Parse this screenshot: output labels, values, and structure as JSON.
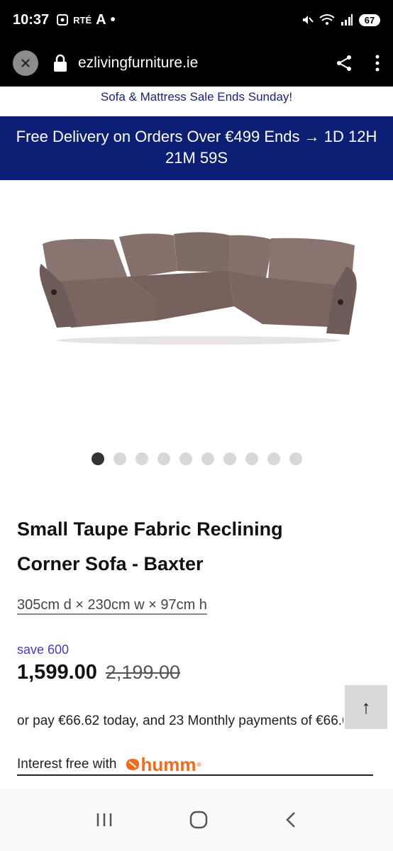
{
  "status_bar": {
    "time": "10:37",
    "left_icons": [
      "screenshot-icon",
      "RTE",
      "A",
      "•"
    ],
    "rte_label": "RTÉ",
    "a_label": "A",
    "dot_label": "•",
    "battery": "67"
  },
  "browser": {
    "url": "ezlivingfurniture.ie"
  },
  "promo_banner": {
    "text": "Sofa & Mattress Sale Ends Sunday!"
  },
  "delivery_banner": {
    "text": "Free Delivery on Orders Over €499 Ends → 1D 12H 21M 59S"
  },
  "carousel": {
    "total": 10,
    "active_index": 0
  },
  "product": {
    "title": "Small Taupe Fabric Reclining Corner Sofa - Baxter",
    "dimensions": "305cm d × 230cm w × 97cm h",
    "save_label": "save 600",
    "price": "1,599.00",
    "old_price": "2,199.00",
    "payment_text": "or pay €66.62 today, and 23 Monthly payments of €66.62",
    "interest_label": "Interest free with",
    "humm_logo": "humm"
  },
  "scroll_top": {
    "label": "↑"
  },
  "colors": {
    "delivery_bg": "#0d1f75",
    "promo_text": "#1a237e",
    "save_text": "#4a3ab8",
    "humm_orange": "#f26b1d"
  }
}
